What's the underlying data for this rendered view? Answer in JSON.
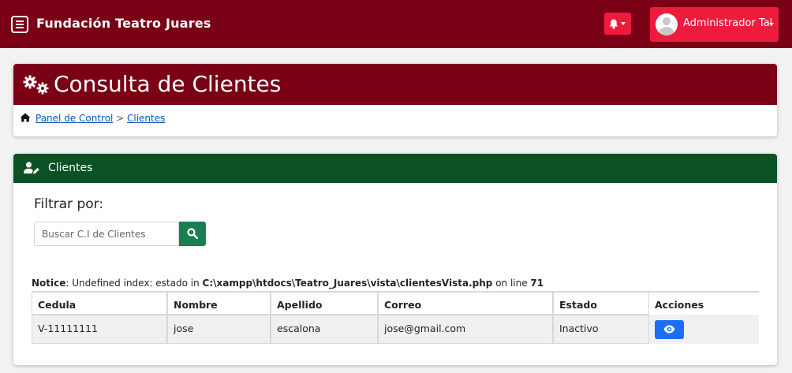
{
  "navbar": {
    "brand": "Fundación Teatro Juares",
    "user_name": "Administrador Tal"
  },
  "page": {
    "title": "Consulta de Clientes",
    "breadcrumb": [
      "Panel de Control",
      "Clientes"
    ],
    "breadcrumb_separator": ">"
  },
  "clients_card": {
    "title": "Clientes",
    "filter_label": "Filtrar por:",
    "search_placeholder": "Buscar C.I de Clientes"
  },
  "notice": {
    "label": "Notice",
    "message": ": Undefined index: estado in ",
    "path": "C:\\xampp\\htdocs\\Teatro_Juares\\vista\\clientesVista.php",
    "on_line": " on line ",
    "line": "71"
  },
  "table": {
    "columns": [
      "Cedula",
      "Nombre",
      "Apellido",
      "Correo",
      "Estado",
      "Acciones"
    ],
    "rows": [
      [
        "V-11111111",
        "jose",
        "escalona",
        "jose@gmail.com",
        "Inactivo"
      ]
    ]
  },
  "colors": {
    "navbar": "#7a0016",
    "accent_red": "#ee1b3d",
    "green_header": "#0a5224",
    "search_button": "#188050",
    "view_button": "#1b6ef5"
  },
  "icons": [
    "menu-icon",
    "bell-icon",
    "user-avatar-icon",
    "gears-icon",
    "home-icon",
    "user-edit-icon",
    "search-icon",
    "eye-icon"
  ]
}
